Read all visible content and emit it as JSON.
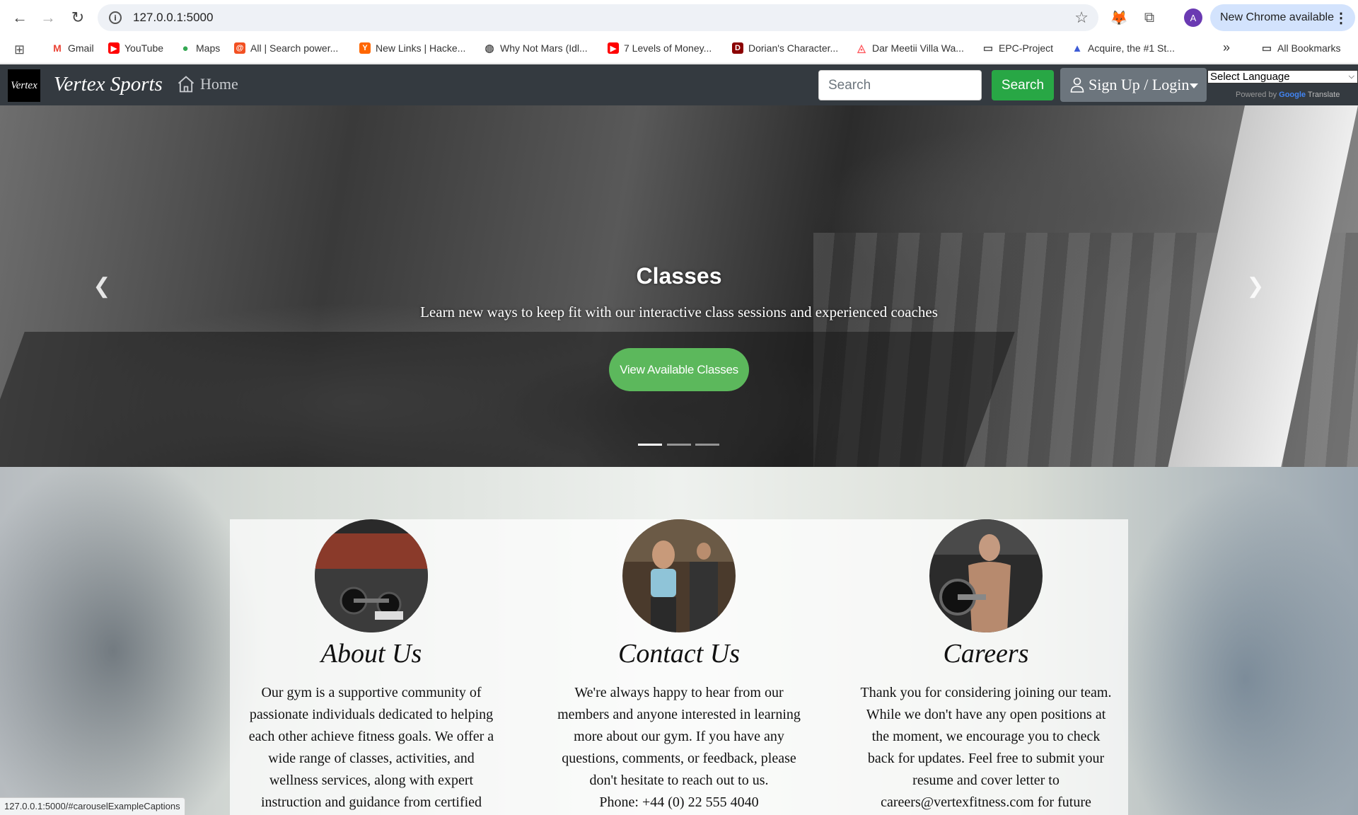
{
  "browser": {
    "url": "127.0.0.1:5000",
    "update_label": "New Chrome available",
    "profile_initial": "A",
    "bookmarks": [
      {
        "label": "Gmail",
        "color": "#ea4335"
      },
      {
        "label": "YouTube",
        "color": "#ff0000"
      },
      {
        "label": "Maps",
        "color": "#34a853"
      },
      {
        "label": "All | Search power...",
        "color": "#f25022"
      },
      {
        "label": "New Links | Hacke...",
        "color": "#ff6600"
      },
      {
        "label": "Why Not Mars (Idl...",
        "color": "#555555"
      },
      {
        "label": "7 Levels of Money...",
        "color": "#ff0000"
      },
      {
        "label": "Dorian's Character...",
        "color": "#8b0000"
      },
      {
        "label": "Dar Meetii Villa Wa...",
        "color": "#ff5a5f"
      },
      {
        "label": "EPC-Project",
        "color": "#555555"
      },
      {
        "label": "Acquire, the #1 St...",
        "color": "#3c5bd6"
      }
    ],
    "overflow_label": "»",
    "all_bookmarks_label": "All Bookmarks",
    "status_url": "127.0.0.1:5000/#carouselExampleCaptions"
  },
  "nav": {
    "logo_text": "Vertex",
    "brand": "Vertex Sports",
    "home_label": "Home",
    "search_placeholder": "Search",
    "search_button": "Search",
    "login_label": "Sign Up / Login",
    "language_select": "Select Language",
    "powered_by": "Powered by",
    "google": "Google",
    "translate": "Translate"
  },
  "carousel": {
    "title": "Classes",
    "text": "Learn new ways to keep fit with our interactive class sessions and experienced coaches",
    "button": "View Available Classes",
    "slide_count": 3,
    "active_slide": 1
  },
  "cards": [
    {
      "title": "About Us",
      "body": "Our gym is a supportive community of passionate individuals dedicated to helping each other achieve fitness goals. We offer a wide range of classes, activities, and wellness services, along with expert instruction and guidance from certified"
    },
    {
      "title": "Contact Us",
      "body": "We're always happy to hear from our members and anyone interested in learning more about our gym. If you have any questions, comments, or feedback, please don't hesitate to reach out to us.",
      "phone": "Phone: +44 (0) 22 555 4040"
    },
    {
      "title": "Careers",
      "body": "Thank you for considering joining our team. While we don't have any open positions at the moment, we encourage you to check back for updates. Feel free to submit your resume and cover letter to careers@vertexfitness.com for future"
    }
  ],
  "colors": {
    "navbar": "#343a40",
    "success": "#28a745",
    "secondary": "#6c757d",
    "cta": "#5cb85c"
  }
}
